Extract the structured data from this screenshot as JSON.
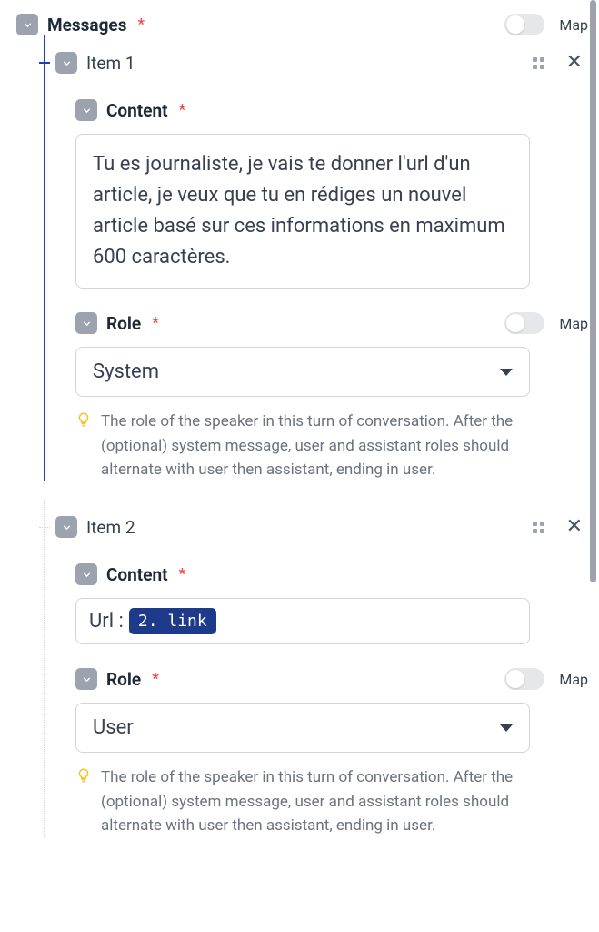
{
  "messages_label": "Messages",
  "map_label": "Map",
  "items": [
    {
      "label": "Item 1",
      "content_label": "Content",
      "content_value": "Tu es journaliste, je vais te donner l'url d'un article, je veux que tu en rédiges un nouvel article basé sur ces informations en maximum 600 caractères.",
      "role_label": "Role",
      "role_value": "System",
      "role_hint": "The role of the speaker in this turn of conversation. After the (optional) system message, user and assistant roles should alternate with user then assistant, ending in user."
    },
    {
      "label": "Item 2",
      "content_label": "Content",
      "url_prefix": "Url :",
      "url_pill": "2. link",
      "role_label": "Role",
      "role_value": "User",
      "role_hint": "The role of the speaker in this turn of conversation. After the (optional) system message, user and assistant roles should alternate with user then assistant, ending in user."
    }
  ]
}
